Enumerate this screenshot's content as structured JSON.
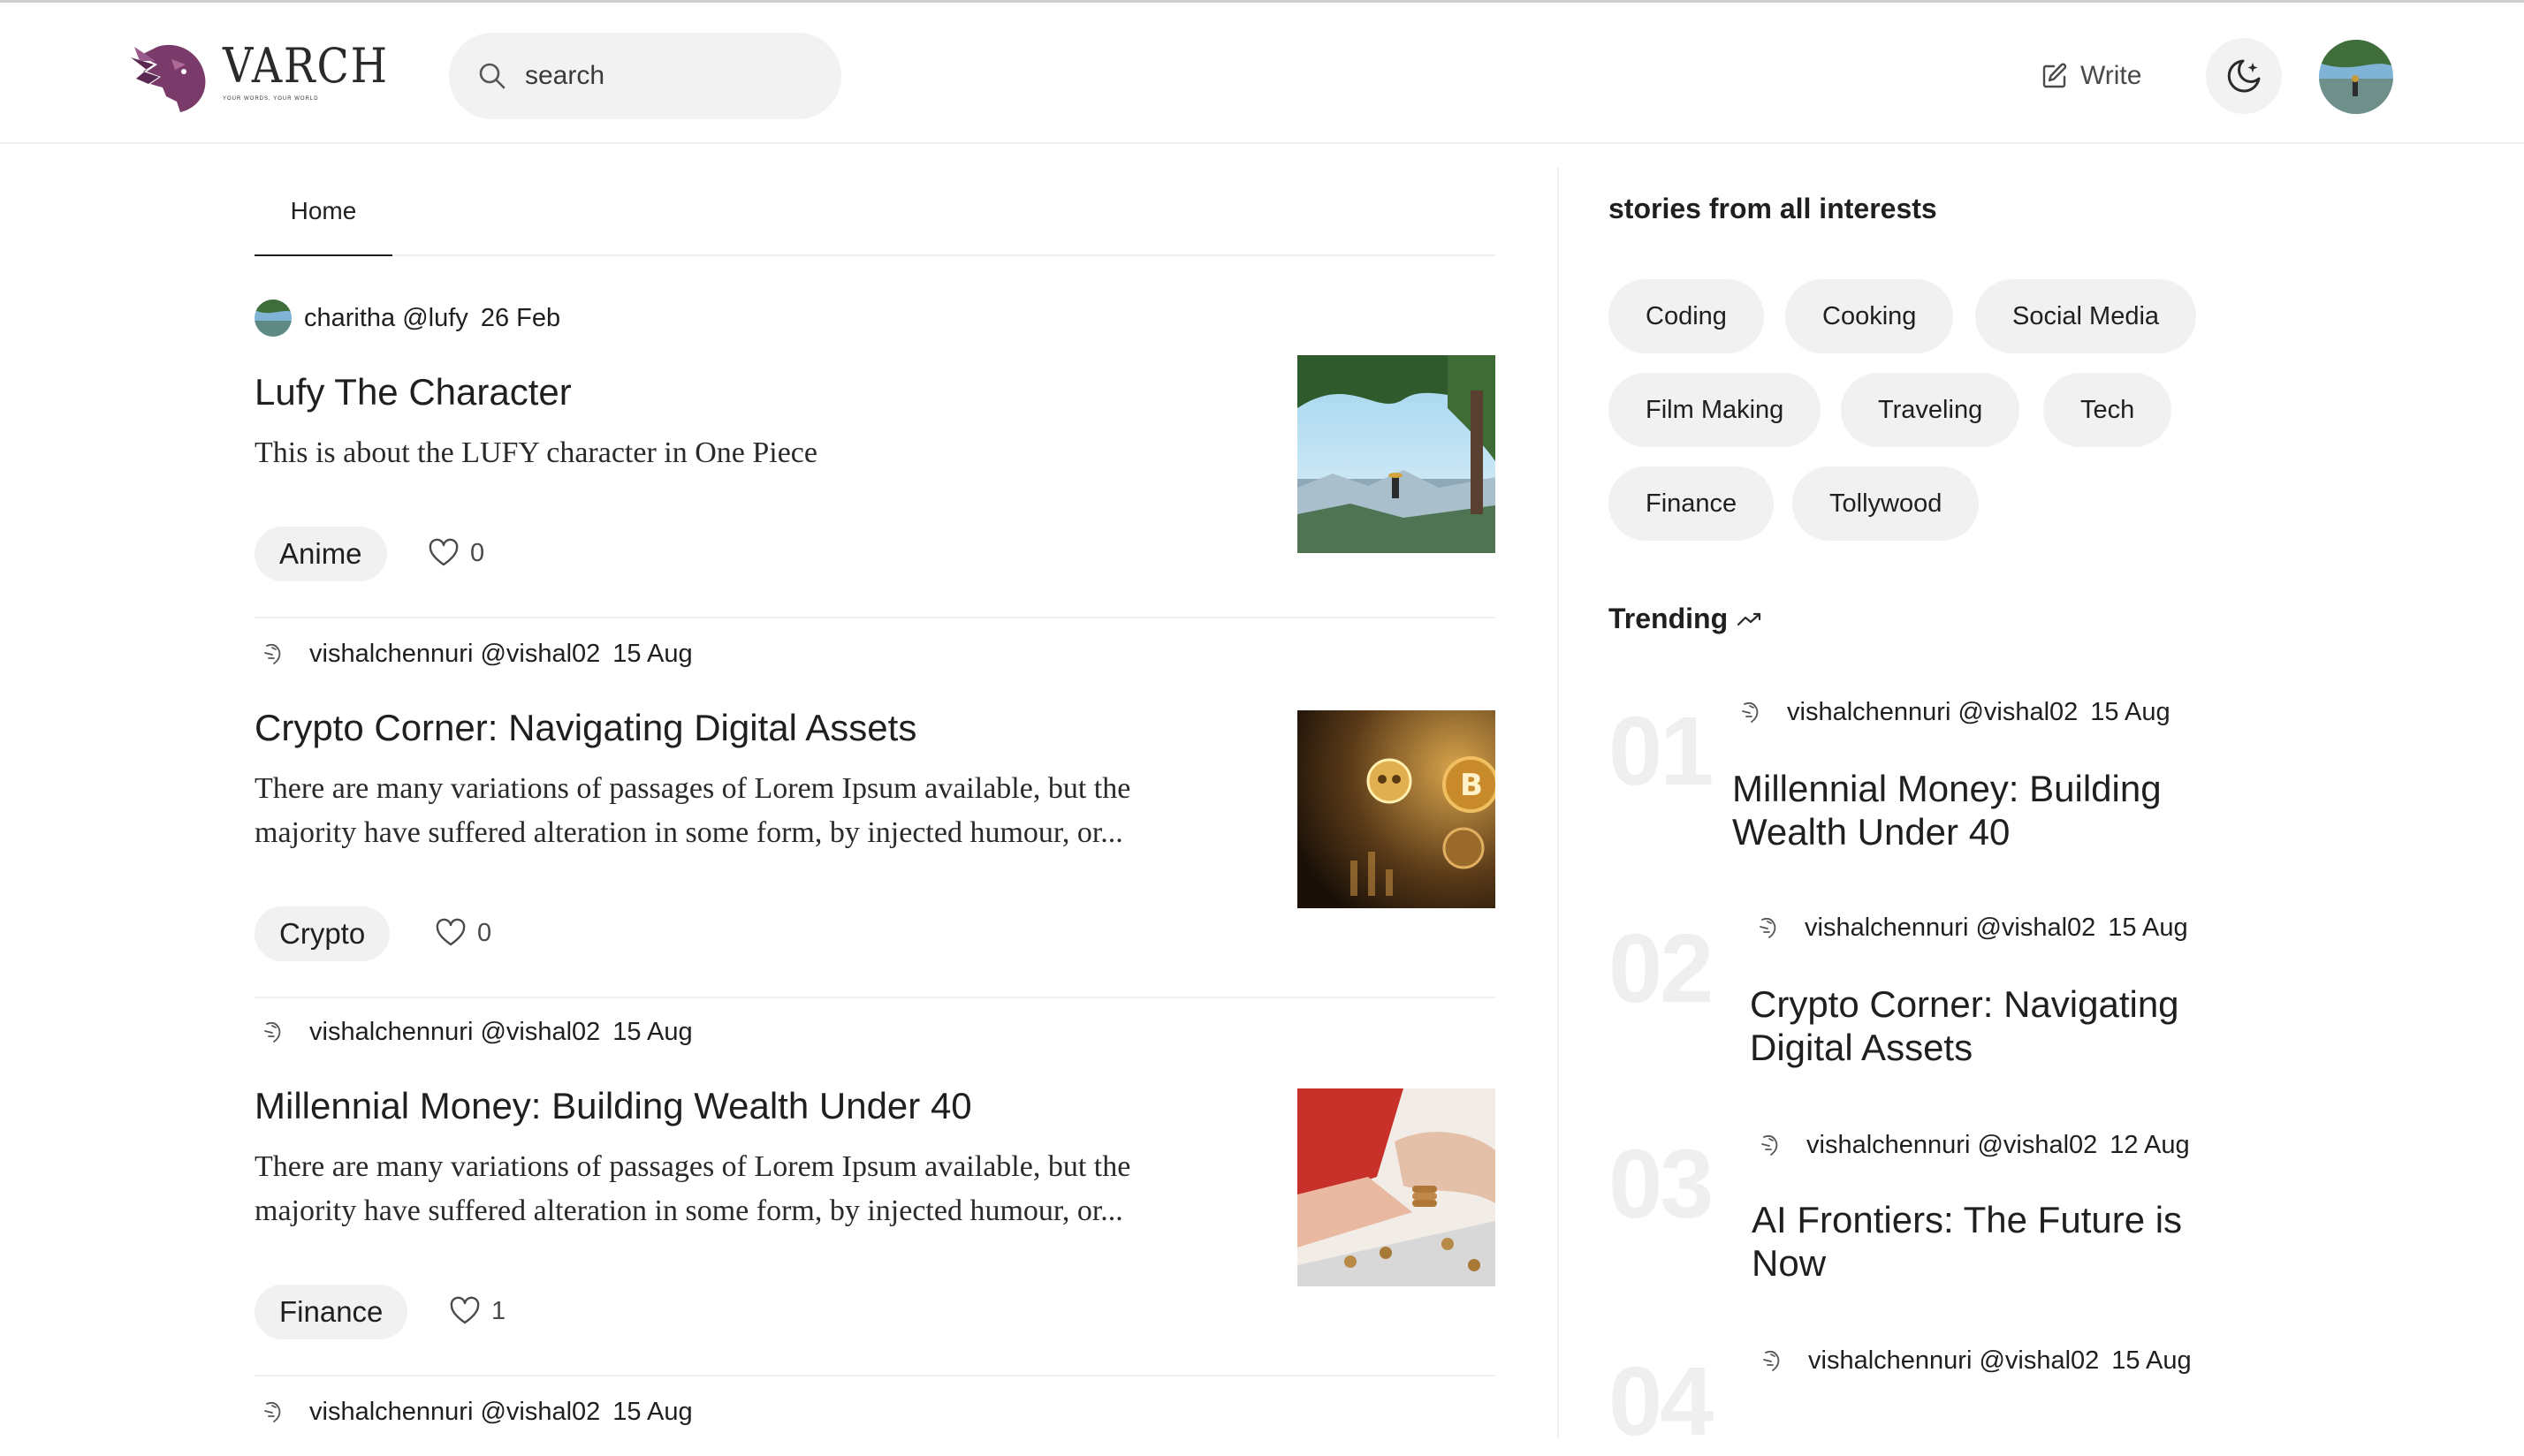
{
  "brand": {
    "name": "VARCH",
    "tagline": "YOUR WORDS, YOUR WORLD"
  },
  "search": {
    "placeholder": "search"
  },
  "header": {
    "write_label": "Write"
  },
  "tabs": [
    {
      "label": "Home"
    }
  ],
  "posts": [
    {
      "author": "charitha",
      "handle": "@lufy",
      "date": "26 Feb",
      "title": "Lufy The Character",
      "description": "This is about the LUFY character in One Piece",
      "tag": "Anime",
      "likes": "0"
    },
    {
      "author": "vishalchennuri",
      "handle": "@vishal02",
      "date": "15 Aug",
      "title": "Crypto Corner: Navigating Digital Assets",
      "description": "There are many variations of passages of Lorem Ipsum available, but the majority have suffered alteration in some form, by injected humour, or...",
      "tag": "Crypto",
      "likes": "0"
    },
    {
      "author": "vishalchennuri",
      "handle": "@vishal02",
      "date": "15 Aug",
      "title": "Millennial Money: Building Wealth Under 40",
      "description": "There are many variations of passages of Lorem Ipsum available, but the majority have suffered alteration in some form, by injected humour, or...",
      "tag": "Finance",
      "likes": "1"
    },
    {
      "author": "vishalchennuri",
      "handle": "@vishal02",
      "date": "15 Aug"
    }
  ],
  "sidebar": {
    "interests_heading": "stories from all interests",
    "interests": [
      "Coding",
      "Cooking",
      "Social Media",
      "Film Making",
      "Traveling",
      "Tech",
      "Finance",
      "Tollywood"
    ],
    "trending_heading": "Trending",
    "trending": [
      {
        "number": "01",
        "author": "vishalchennuri",
        "handle": "@vishal02",
        "date": "15 Aug",
        "title": "Millennial Money: Building Wealth Under 40"
      },
      {
        "number": "02",
        "author": "vishalchennuri",
        "handle": "@vishal02",
        "date": "15 Aug",
        "title": "Crypto Corner: Navigating Digital Assets"
      },
      {
        "number": "03",
        "author": "vishalchennuri",
        "handle": "@vishal02",
        "date": "12 Aug",
        "title": "AI Frontiers: The Future is Now"
      },
      {
        "number": "04",
        "author": "vishalchennuri",
        "handle": "@vishal02",
        "date": "15 Aug"
      }
    ]
  },
  "colors": {
    "logo_purple": "#7a3a6a",
    "pill_bg": "#f1f1f1",
    "text": "#1f1f1f",
    "muted": "#4a4a4a",
    "trend_number": "#efefef"
  }
}
